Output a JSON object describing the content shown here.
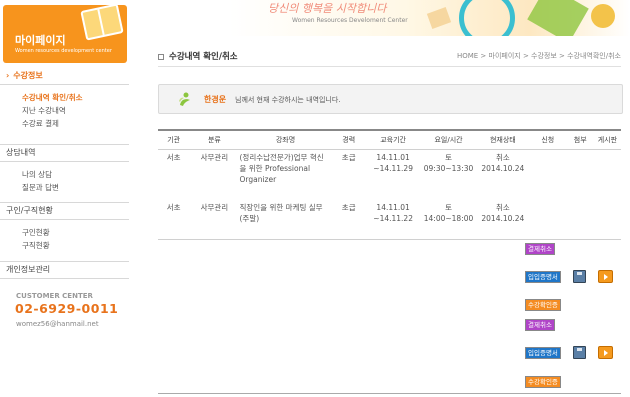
{
  "sidebar": {
    "title": "마이페이지",
    "subtitle": "Women resources development center",
    "sections": [
      {
        "label": "수강정보",
        "items": [
          "수강내역 확인/취소",
          "지난 수강내역",
          "수강료 결제"
        ]
      },
      {
        "label": "상담내역",
        "items": [
          "나의 상담",
          "질문과 답변"
        ]
      },
      {
        "label": "구인/구직현황",
        "items": [
          "구인현황",
          "구직현황"
        ]
      },
      {
        "label": "개인정보관리",
        "items": []
      }
    ],
    "customer_center": {
      "title": "CUSTOMER CENTER",
      "phone": "02-6929-0011",
      "email": "womez56@hanmail.net"
    }
  },
  "banner": {
    "title": "당신의 행복을 시작합니다",
    "subtitle": "Women Resources Develoment Center"
  },
  "page": {
    "title": "수강내역 확인/취소",
    "breadcrumb": "HOME > 마이페이지 > 수강정보 > 수강내역확인/취소"
  },
  "notice": {
    "name": "한경운",
    "text": "님께서 현재 수강하시는 내역입니다."
  },
  "table": {
    "headers": [
      "기관",
      "분류",
      "강좌명",
      "경력",
      "교육기간",
      "요일/시간",
      "현재상태",
      "신청",
      "첨부",
      "게시판"
    ],
    "rows": [
      {
        "org": "서초",
        "category": "사무관리",
        "course": "(정리수납전문가)업무 혁신을 위한 Professional Organizer",
        "level": "초급",
        "period": "14.11.01 ~14.11.29",
        "time": "토 09:30~13:30",
        "status": "취소 2014.10.24"
      },
      {
        "org": "서초",
        "category": "사무관리",
        "course": "직장인을 위한 마케팅 실무(주말)",
        "level": "초급",
        "period": "14.11.01 ~14.11.22",
        "time": "토 14:00~18:00",
        "status": "취소 2014.10.24"
      }
    ]
  },
  "buttons": {
    "cancel_payment": "결제취소",
    "deposit_receipt": "입입증명서",
    "enroll_confirm": "수강확인증"
  }
}
